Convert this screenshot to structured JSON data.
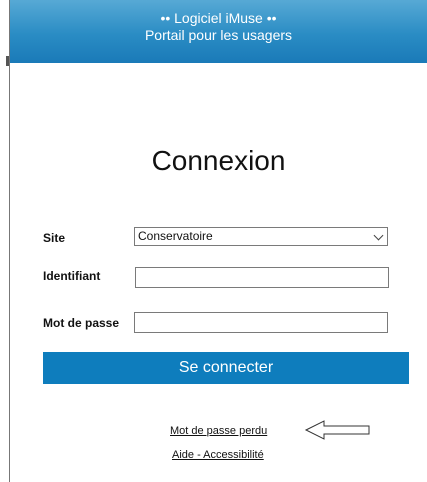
{
  "header": {
    "title": "•• Logiciel iMuse ••",
    "subtitle": "Portail pour les usagers"
  },
  "login": {
    "heading": "Connexion",
    "site_label": "Site",
    "site_selected": "Conservatoire",
    "identifiant_label": "Identifiant",
    "identifiant_value": "",
    "password_label": "Mot de passe",
    "password_value": "",
    "submit_label": "Se connecter"
  },
  "links": {
    "lost_password": "Mot de passe perdu",
    "help": "Aide - Accessibilité"
  },
  "icons": {
    "select": "chevron-down-icon",
    "annotation": "left-arrow-icon"
  },
  "colors": {
    "header": "#2a8cc4",
    "button": "#0e7dbd"
  }
}
